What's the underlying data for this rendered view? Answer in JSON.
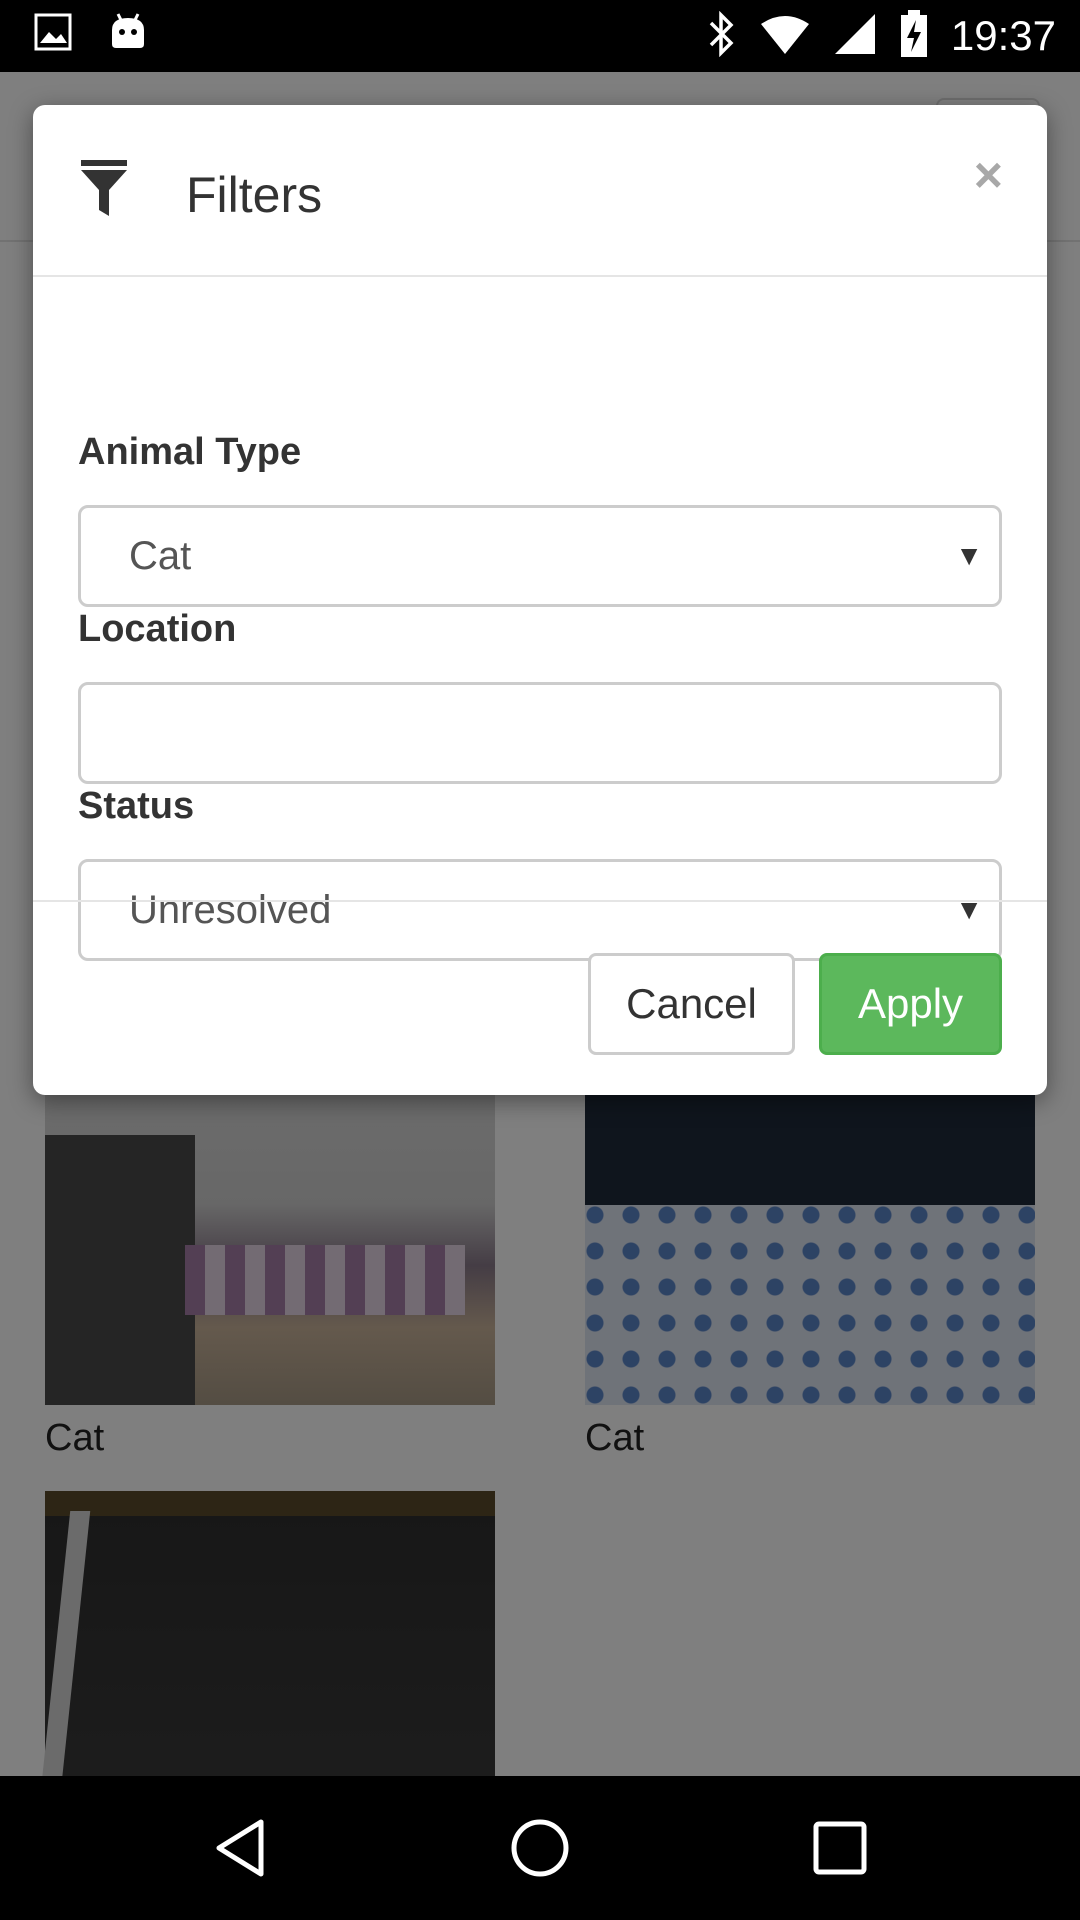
{
  "status_bar": {
    "time": "19:37",
    "left_icons": [
      "image-icon",
      "android-icon"
    ],
    "right_icons": [
      "bluetooth-icon",
      "wifi-icon",
      "signal-icon",
      "battery-charging-icon"
    ]
  },
  "modal": {
    "title": "Filters",
    "icon": "filter-icon",
    "close_label": "×",
    "fields": [
      {
        "label": "Animal Type",
        "type": "select",
        "value": "Cat"
      },
      {
        "label": "Location",
        "type": "text",
        "value": ""
      },
      {
        "label": "Status",
        "type": "select",
        "value": "Unresolved"
      }
    ],
    "cancel_label": "Cancel",
    "apply_label": "Apply",
    "apply_color": "#5cb85c"
  },
  "background_grid": [
    {
      "caption": "Cat"
    },
    {
      "caption": "Cat"
    },
    {
      "caption": ""
    }
  ],
  "nav_bar": [
    "back-icon",
    "home-icon",
    "recents-icon"
  ]
}
